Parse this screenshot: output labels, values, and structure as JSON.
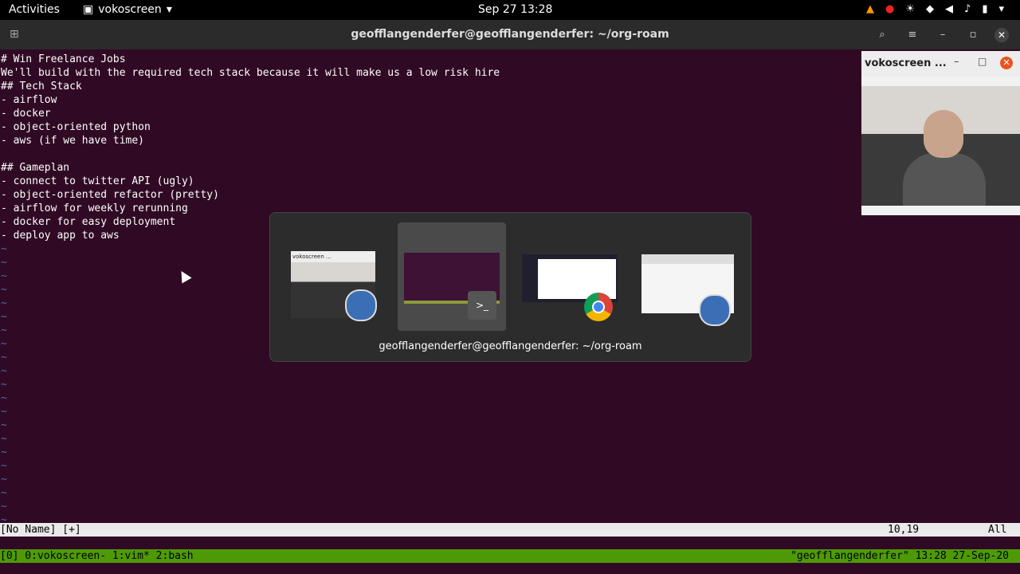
{
  "topbar": {
    "activities": "Activities",
    "app_name": "vokoscreen",
    "clock": "Sep 27  13:28"
  },
  "window": {
    "title": "geofflangenderfer@geofflangenderfer: ~/org-roam"
  },
  "editor": {
    "lines": [
      "# Win Freelance Jobs",
      "We'll build with the required tech stack because it will make us a low risk hire",
      "## Tech Stack",
      "- airflow",
      "- docker",
      "- object-oriented python",
      "- aws (if we have time)",
      "",
      "## Gameplan",
      "- connect to twitter API (ugly)",
      "- object-oriented refactor (pretty)",
      "- airflow for weekly rerunning",
      "- docker for easy deployment",
      "- deploy app to aws"
    ],
    "tilde": "~"
  },
  "statusline": {
    "filename": "[No Name] [+]",
    "position": "10,19",
    "scroll": "All"
  },
  "tmux": {
    "left": "[0] 0:vokoscreen- 1:vim* 2:bash",
    "right": "\"geofflangenderfer\" 13:28 27-Sep-20"
  },
  "voko_window": {
    "title": "vokoscreen ..."
  },
  "switcher": {
    "selected_label": "geofflangenderfer@geofflangenderfer: ~/org-roam",
    "mini_voko_title": "vokoscreen ...",
    "items": [
      "vokoscreen",
      "terminal",
      "chrome",
      "vokoscreen-settings"
    ]
  },
  "colors": {
    "terminal_bg": "#300a24",
    "tmux_bar": "#4e9a06",
    "accent": "#e95420"
  }
}
